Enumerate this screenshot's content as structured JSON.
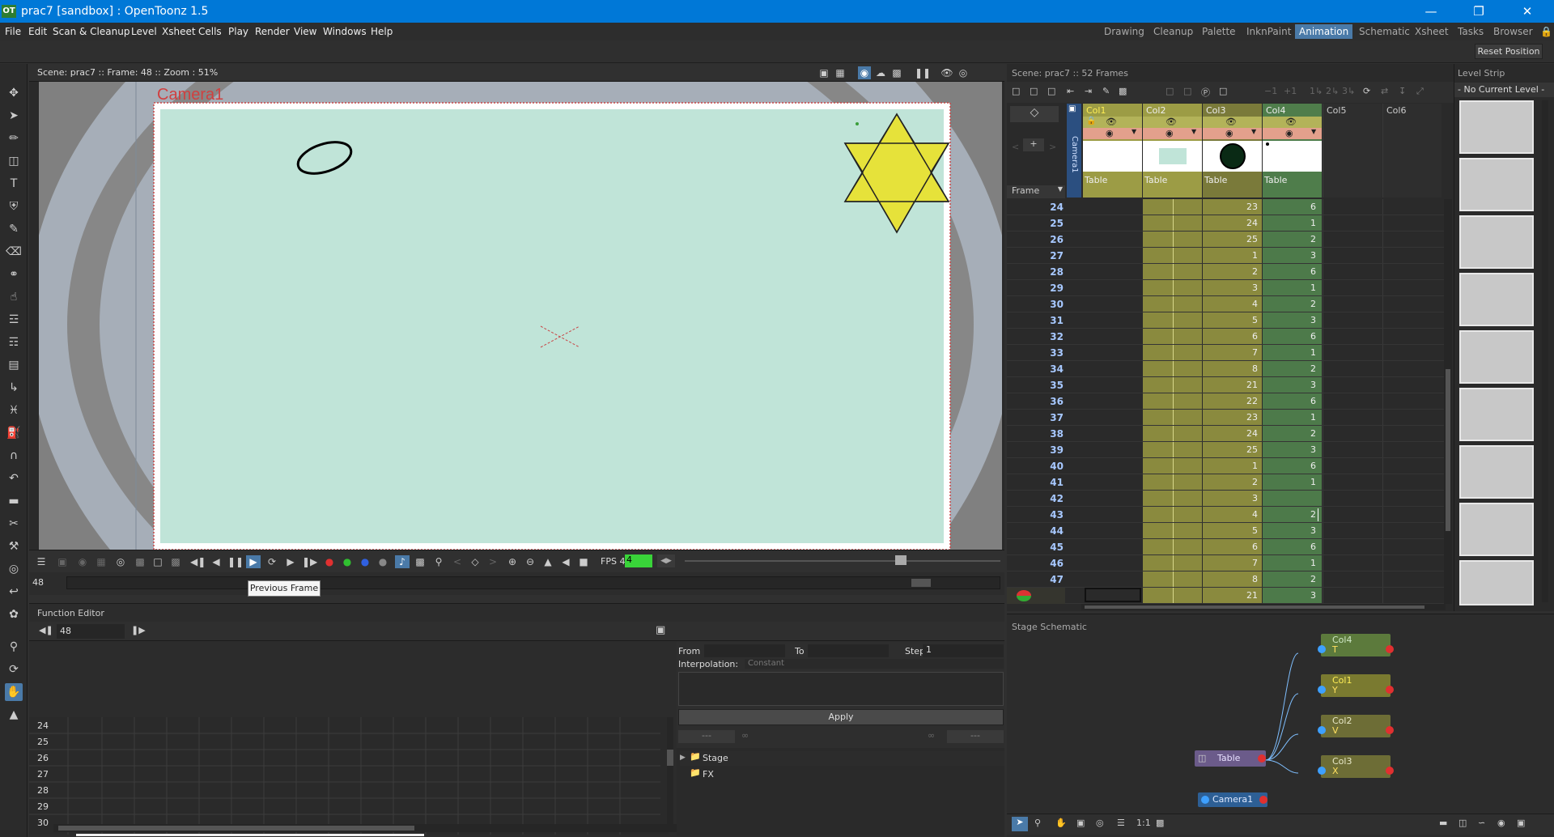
{
  "window": {
    "title": "prac7 [sandbox] : OpenToonz 1.5",
    "logo": "OT"
  },
  "menu": [
    "File",
    "Edit",
    "Scan & Cleanup",
    "Level",
    "Xsheet",
    "Cells",
    "Play",
    "Render",
    "View",
    "Windows",
    "Help"
  ],
  "rooms": [
    "Drawing",
    "Cleanup",
    "Palette",
    "InknPaint",
    "Animation",
    "Schematic",
    "Xsheet",
    "Tasks",
    "Browser"
  ],
  "active_room": "Animation",
  "reset_position": "Reset Position",
  "viewer": {
    "info": "Scene: prac7  ::  Frame: 48  ::  Zoom : 51%",
    "camera_label": "Camera1",
    "fps_label": "FPS 4/",
    "fps_value": "4",
    "frame_field": "48",
    "tooltip": "Previous Frame"
  },
  "function_editor": {
    "title": "Function Editor",
    "frame": "48",
    "from_label": "From",
    "to_label": "To",
    "step_label": "Step",
    "step_value": "1",
    "interp_label": "Interpolation:",
    "interp_value": "Constant",
    "apply": "Apply",
    "dash1": "---",
    "dash2": "---",
    "tree": [
      "Stage",
      "FX"
    ],
    "rows": [
      "24",
      "25",
      "26",
      "27",
      "28",
      "29",
      "30"
    ]
  },
  "xsheet": {
    "scene_info": "Scene: prac7   ::   52 Frames",
    "frame_label": "Frame",
    "camera_col": "Camera1",
    "columns": [
      {
        "name": "Col1",
        "pegbar": "Table"
      },
      {
        "name": "Col2",
        "pegbar": "Table"
      },
      {
        "name": "Col3",
        "pegbar": "Table"
      },
      {
        "name": "Col4",
        "pegbar": "Table"
      },
      {
        "name": "Col5",
        "pegbar": ""
      },
      {
        "name": "Col6",
        "pegbar": ""
      }
    ],
    "rows": [
      {
        "f": "24",
        "c3": "23",
        "c4": "6"
      },
      {
        "f": "25",
        "c3": "24",
        "c4": "1"
      },
      {
        "f": "26",
        "c3": "25",
        "c4": "2"
      },
      {
        "f": "27",
        "c3": "1",
        "c4": "3"
      },
      {
        "f": "28",
        "c3": "2",
        "c4": "6"
      },
      {
        "f": "29",
        "c3": "3",
        "c4": "1"
      },
      {
        "f": "30",
        "c3": "4",
        "c4": "2"
      },
      {
        "f": "31",
        "c3": "5",
        "c4": "3"
      },
      {
        "f": "32",
        "c3": "6",
        "c4": "6"
      },
      {
        "f": "33",
        "c3": "7",
        "c4": "1"
      },
      {
        "f": "34",
        "c3": "8",
        "c4": "2"
      },
      {
        "f": "35",
        "c3": "21",
        "c4": "3"
      },
      {
        "f": "36",
        "c3": "22",
        "c4": "6"
      },
      {
        "f": "37",
        "c3": "23",
        "c4": "1"
      },
      {
        "f": "38",
        "c3": "24",
        "c4": "2"
      },
      {
        "f": "39",
        "c3": "25",
        "c4": "3"
      },
      {
        "f": "40",
        "c3": "1",
        "c4": "6"
      },
      {
        "f": "41",
        "c3": "2",
        "c4": "1"
      },
      {
        "f": "42",
        "c3": "3",
        "c4": ""
      },
      {
        "f": "43",
        "c3": "4",
        "c4": "2"
      },
      {
        "f": "44",
        "c3": "5",
        "c4": "3"
      },
      {
        "f": "45",
        "c3": "6",
        "c4": "6"
      },
      {
        "f": "46",
        "c3": "7",
        "c4": "1"
      },
      {
        "f": "47",
        "c3": "8",
        "c4": "2"
      },
      {
        "f": "48",
        "c3": "21",
        "c4": "3"
      }
    ]
  },
  "level_strip": {
    "title": "Level Strip",
    "current": "- No Current Level -"
  },
  "schematic": {
    "title": "Stage Schematic",
    "nodes": [
      {
        "name": "Col4",
        "channel": "T"
      },
      {
        "name": "Col1",
        "channel": "Y"
      },
      {
        "name": "Col2",
        "channel": "V"
      },
      {
        "name": "Col3",
        "channel": "X"
      },
      {
        "name": "Table",
        "channel": ""
      },
      {
        "name": "Camera1",
        "channel": ""
      }
    ],
    "zoom_label": "1:1"
  },
  "colors": {
    "accent": "#4a7aa8",
    "titlebar": "#0078d7",
    "canvas_bg": "#c0e4d8",
    "star": "#e6e23a",
    "col_yellow": "#8a8a3e",
    "col_green": "#4d7a4a"
  }
}
